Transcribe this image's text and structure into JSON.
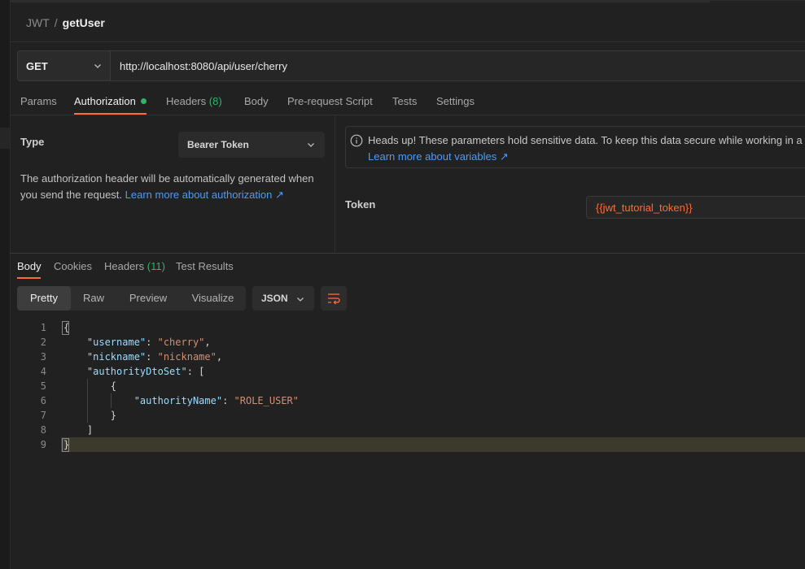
{
  "breadcrumb": {
    "collection": "JWT",
    "separator": "/",
    "request": "getUser"
  },
  "request": {
    "method": "GET",
    "url": "http://localhost:8080/api/user/cherry"
  },
  "request_tabs": [
    {
      "label": "Params"
    },
    {
      "label": "Authorization",
      "active": true,
      "dot": true
    },
    {
      "label": "Headers",
      "count": "(8)"
    },
    {
      "label": "Body"
    },
    {
      "label": "Pre-request Script"
    },
    {
      "label": "Tests"
    },
    {
      "label": "Settings"
    }
  ],
  "auth": {
    "type_label": "Type",
    "type_value": "Bearer Token",
    "description": "The authorization header will be automatically generated when you send the request.",
    "description_link": "Learn more about authorization ↗",
    "notice_text": "Heads up! These parameters hold sensitive data. To keep this data secure while working in a co",
    "notice_link": "Learn more about variables ↗",
    "token_label": "Token",
    "token_value": "{{jwt_tutorial_token}}"
  },
  "response_tabs": [
    {
      "label": "Body",
      "active": true
    },
    {
      "label": "Cookies"
    },
    {
      "label": "Headers",
      "count": "(11)"
    },
    {
      "label": "Test Results"
    }
  ],
  "view_modes": [
    "Pretty",
    "Raw",
    "Preview",
    "Visualize"
  ],
  "active_view": "Pretty",
  "format": "JSON",
  "code": {
    "line_numbers": [
      "1",
      "2",
      "3",
      "4",
      "5",
      "6",
      "7",
      "8",
      "9"
    ],
    "keys": {
      "username": "\"username\"",
      "nickname": "\"nickname\"",
      "authorityDtoSet": "\"authorityDtoSet\"",
      "authorityName": "\"authorityName\""
    },
    "values": {
      "username": "\"cherry\"",
      "nickname": "\"nickname\"",
      "authorityName": "\"ROLE_USER\""
    }
  },
  "colors": {
    "accent": "#ff6c37",
    "link": "#4c9bf7",
    "count_green": "#2fb56b"
  },
  "icons": [
    "chevron-down-icon",
    "info-icon",
    "wrap-lines-icon",
    "external-link-arrow"
  ]
}
